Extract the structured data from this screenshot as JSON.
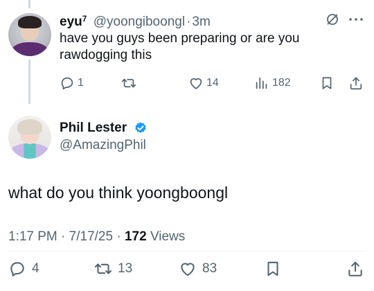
{
  "reply": {
    "name": "eyu",
    "name_sup": "7",
    "handle": "@yoongiboongl",
    "separator": "·",
    "time": "3m",
    "text_line1": "have you guys been preparing or are you",
    "text_line2": "rawdogging this",
    "actions": {
      "replies": "1",
      "reposts": "",
      "likes": "14",
      "views": "182"
    }
  },
  "tweet": {
    "name": "Phil Lester",
    "handle": "@AmazingPhil",
    "text": "what do you think yoongboongl",
    "time": "1:17 PM",
    "date": "7/17/25",
    "separator": "·",
    "views_count": "172",
    "views_label": "Views",
    "actions": {
      "replies": "4",
      "reposts": "13",
      "likes": "83"
    }
  },
  "colors": {
    "text": "#0f1419",
    "secondary": "#536471",
    "verified": "#1d9bf0",
    "thread_line": "#cfd9de"
  },
  "icons": [
    "mute-icon",
    "more-icon",
    "reply-icon",
    "repost-icon",
    "like-icon",
    "views-icon",
    "bookmark-icon",
    "share-icon",
    "verified-badge-icon"
  ]
}
